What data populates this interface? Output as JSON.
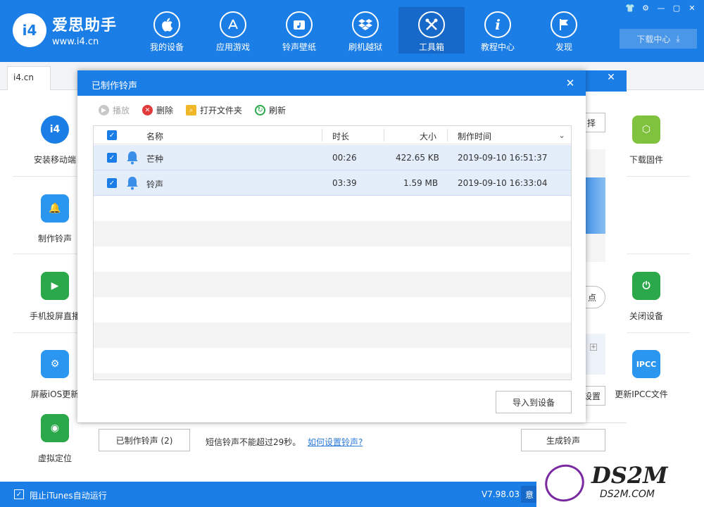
{
  "app": {
    "logo_badge": "i4",
    "title": "爱思助手",
    "url": "www.i4.cn",
    "brand_color": "#1b7de6"
  },
  "nav": [
    {
      "label": "我的设备",
      "icon": "apple-icon"
    },
    {
      "label": "应用游戏",
      "icon": "app-store-icon"
    },
    {
      "label": "铃声壁纸",
      "icon": "music-folder-icon"
    },
    {
      "label": "刷机越狱",
      "icon": "dropbox-icon"
    },
    {
      "label": "工具箱",
      "icon": "tools-icon",
      "active": true
    },
    {
      "label": "教程中心",
      "icon": "info-icon"
    },
    {
      "label": "发现",
      "icon": "flag-icon"
    }
  ],
  "window_controls": [
    "shirt-icon",
    "gear-icon",
    "minimize-icon",
    "restore-icon",
    "close-icon"
  ],
  "download_center": "下载中心",
  "tab": "i4.cn",
  "left_tools": [
    {
      "label": "安装移动端",
      "icon": "i4-app-icon",
      "color": "#1b7de6"
    },
    {
      "label": "制作铃声",
      "icon": "bell-plus-icon",
      "color": "#2b96f0"
    },
    {
      "label": "手机投屏直播",
      "icon": "screen-mirror-icon",
      "color": "#2aa84a"
    },
    {
      "label": "屏蔽iOS更新",
      "icon": "gear-block-icon",
      "color": "#2b96f0"
    },
    {
      "label": "虚拟定位",
      "icon": "location-pin-icon",
      "color": "#2aa84a"
    }
  ],
  "right_tools": [
    {
      "label": "下载固件",
      "icon": "cube-icon",
      "color": "#7fc23e"
    },
    {
      "label": "关闭设备",
      "icon": "power-icon",
      "color": "#2aa84a"
    },
    {
      "label": "更新IPCC文件",
      "icon": "ipcc-icon",
      "color": "#2b96f0",
      "badge": "IPCC"
    }
  ],
  "bg_panel": {
    "partial_select": "择",
    "partial_point": "点",
    "partial_settings": "设置",
    "made_ringtones_btn": "已制作铃声 (2)",
    "hint": "短信铃声不能超过29秒。",
    "link": "如何设置铃声?",
    "generate_btn": "生成铃声"
  },
  "statusbar": {
    "checkbox_label": "阻止iTunes自动运行",
    "version": "V7.98.03",
    "partial": "意"
  },
  "watermark": {
    "main": "DS2M",
    "sub": "DS2M.COM"
  },
  "dialog": {
    "title": "已制作铃声",
    "toolbar": {
      "play": "播放",
      "delete": "删除",
      "open_folder": "打开文件夹",
      "refresh": "刷新"
    },
    "columns": {
      "name": "名称",
      "duration": "时长",
      "size": "大小",
      "created": "制作时间"
    },
    "rows": [
      {
        "name": "芒种",
        "duration": "00:26",
        "size": "422.65 KB",
        "created": "2019-09-10 16:51:37",
        "checked": true
      },
      {
        "name": "铃声",
        "duration": "03:39",
        "size": "1.59 MB",
        "created": "2019-09-10 16:33:04",
        "checked": true
      }
    ],
    "import_btn": "导入到设备"
  }
}
